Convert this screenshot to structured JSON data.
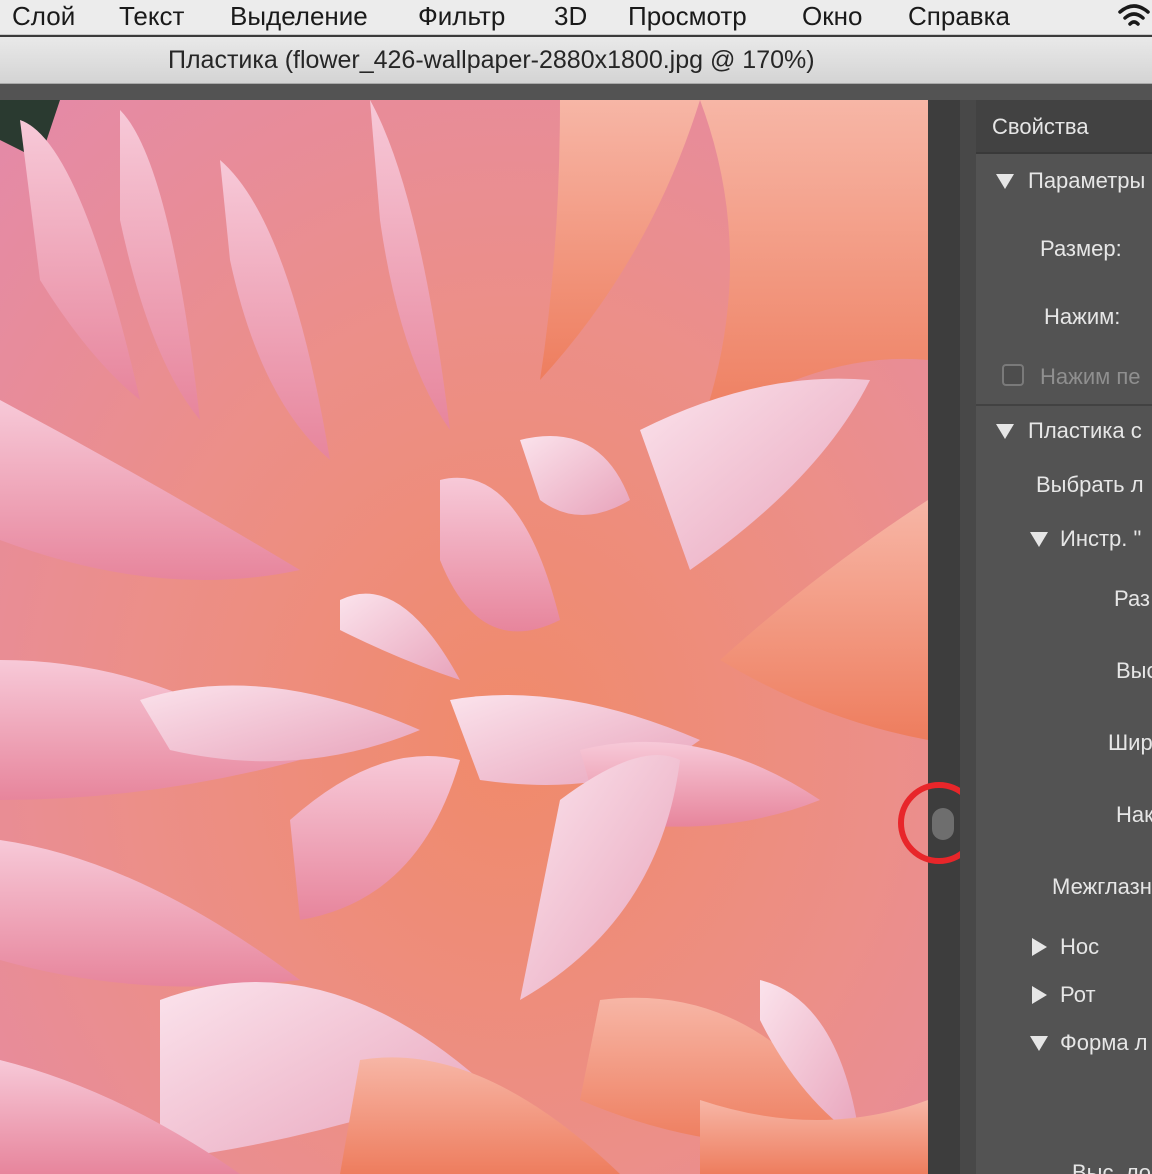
{
  "menubar": {
    "items": [
      "Слой",
      "Текст",
      "Выделение",
      "Фильтр",
      "3D",
      "Просмотр",
      "Окно",
      "Справка"
    ],
    "status_icon": "wifi-icon"
  },
  "window": {
    "title": "Пластика (flower_426-wallpaper-2880x1800.jpg @ 170%)"
  },
  "canvas": {
    "image": "pink-dahlia-flower-closeup"
  },
  "annotation": {
    "highlight": "red-circle-around-panel-splitter",
    "color": "#e8262a"
  },
  "properties": {
    "header": "Свойства",
    "sections": {
      "brush": {
        "title": "Параметры",
        "size_label": "Размер:",
        "pressure_label": "Нажим:",
        "pen_pressure_label": "Нажим пе"
      },
      "face": {
        "title": "Пластика с",
        "select_face": "Выбрать л",
        "eyes_group": "Инстр. \"",
        "size": "Раз",
        "height": "Выс",
        "width": "Шир",
        "tilt": "Нак",
        "distance": "Межглазн",
        "nose": "Нос",
        "mouth": "Рот",
        "face_shape": "Форма л",
        "bottom_partial": "Выс. ло"
      }
    }
  },
  "colors": {
    "menubar_bg": "#ececec",
    "panel_bg": "#535353",
    "panel_header_bg": "#424242",
    "panel_text": "#e6e6e6"
  }
}
